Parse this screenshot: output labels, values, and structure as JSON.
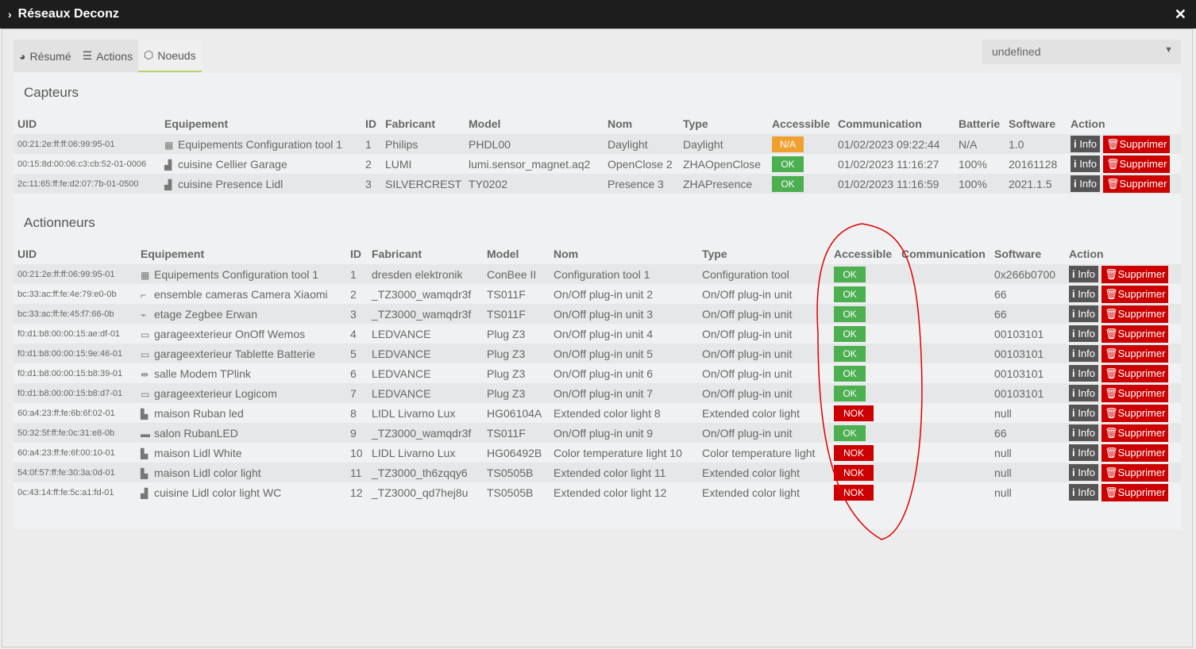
{
  "window": {
    "title": "Réseaux Deconz",
    "close": "✕"
  },
  "tabs": [
    {
      "label": "Résumé",
      "icon": "dashboard-icon"
    },
    {
      "label": "Actions",
      "icon": "sliders-icon"
    },
    {
      "label": "Noeuds",
      "icon": "cube-icon"
    }
  ],
  "select": {
    "value": "undefined"
  },
  "capteurs": {
    "title": "Capteurs",
    "headers": [
      "UID",
      "Equipement",
      "ID",
      "Fabricant",
      "Model",
      "Nom",
      "Type",
      "Accessible",
      "Communication",
      "Batterie",
      "Software",
      "Action"
    ],
    "rows": [
      [
        "00:21:2e:ff:ff:06:99:95-01",
        "Equipements Configuration tool 1",
        "1",
        "Philips",
        "PHDL00",
        "Daylight",
        "Daylight",
        "N/A",
        "01/02/2023 09:22:44",
        "N/A",
        "1.0"
      ],
      [
        "00:15:8d:00:06:c3:cb:52-01-0006",
        "cuisine Cellier Garage",
        "2",
        "LUMI",
        "lumi.sensor_magnet.aq2",
        "OpenClose 2",
        "ZHAOpenClose",
        "OK",
        "01/02/2023 11:16:27",
        "100%",
        "20161128"
      ],
      [
        "2c:11:65:ff:fe:d2:07:7b-01-0500",
        "cuisine Presence Lidl",
        "3",
        "SILVERCREST",
        "TY0202",
        "Presence 3",
        "ZHAPresence",
        "OK",
        "01/02/2023 11:16:59",
        "100%",
        "2021.1.5"
      ]
    ]
  },
  "actionneurs": {
    "title": "Actionneurs",
    "headers": [
      "UID",
      "Equipement",
      "ID",
      "Fabricant",
      "Model",
      "Nom",
      "Type",
      "Accessible",
      "Communication",
      "Software",
      "Action"
    ],
    "rows": [
      [
        "00:21:2e:ff:ff:06:99:95-01",
        "Equipements Configuration tool 1",
        "1",
        "dresden elektronik",
        "ConBee II",
        "Configuration tool 1",
        "Configuration tool",
        "OK",
        "",
        "0x266b0700"
      ],
      [
        "bc:33:ac:ff:fe:4e:79:e0-0b",
        "ensemble cameras Camera Xiaomi",
        "2",
        "_TZ3000_wamqdr3f",
        "TS011F",
        "On/Off plug-in unit 2",
        "On/Off plug-in unit",
        "OK",
        "",
        "66"
      ],
      [
        "bc:33:ac:ff:fe:45:f7:66-0b",
        "etage Zegbee Erwan",
        "3",
        "_TZ3000_wamqdr3f",
        "TS011F",
        "On/Off plug-in unit 3",
        "On/Off plug-in unit",
        "OK",
        "",
        "66"
      ],
      [
        "f0:d1:b8:00:00:15:ae:df-01",
        "garageexterieur OnOff Wemos",
        "4",
        "LEDVANCE",
        "Plug Z3",
        "On/Off plug-in unit 4",
        "On/Off plug-in unit",
        "OK",
        "",
        "00103101"
      ],
      [
        "f0:d1:b8:00:00:15:9e:46-01",
        "garageexterieur Tablette Batterie",
        "5",
        "LEDVANCE",
        "Plug Z3",
        "On/Off plug-in unit 5",
        "On/Off plug-in unit",
        "OK",
        "",
        "00103101"
      ],
      [
        "f0:d1:b8:00:00:15:b8:39-01",
        "salle Modem TPlink",
        "6",
        "LEDVANCE",
        "Plug Z3",
        "On/Off plug-in unit 6",
        "On/Off plug-in unit",
        "OK",
        "",
        "00103101"
      ],
      [
        "f0:d1:b8:00:00:15:b8:d7-01",
        "garageexterieur Logicom",
        "7",
        "LEDVANCE",
        "Plug Z3",
        "On/Off plug-in unit 7",
        "On/Off plug-in unit",
        "OK",
        "",
        "00103101"
      ],
      [
        "60:a4:23:ff:fe:6b:6f:02-01",
        "maison Ruban led",
        "8",
        "LIDL Livarno Lux",
        "HG06104A",
        "Extended color light 8",
        "Extended color light",
        "NOK",
        "",
        "null"
      ],
      [
        "50:32:5f:ff:fe:0c:31:e8-0b",
        "salon RubanLED",
        "9",
        "_TZ3000_wamqdr3f",
        "TS011F",
        "On/Off plug-in unit 9",
        "On/Off plug-in unit",
        "OK",
        "",
        "66"
      ],
      [
        "60:a4:23:ff:fe:6f:00:10-01",
        "maison Lidl White",
        "10",
        "LIDL Livarno Lux",
        "HG06492B",
        "Color temperature light 10",
        "Color temperature light",
        "NOK",
        "",
        "null"
      ],
      [
        "54:0f:57:ff:fe:30:3a:0d-01",
        "maison Lidl color light",
        "11",
        "_TZ3000_th6zqqy6",
        "TS0505B",
        "Extended color light 11",
        "Extended color light",
        "NOK",
        "",
        "null"
      ],
      [
        "0c:43:14:ff:fe:5c:a1:fd-01",
        "cuisine Lidl color light WC",
        "12",
        "_TZ3000_qd7hej8u",
        "TS0505B",
        "Extended color light 12",
        "Extended color light",
        "NOK",
        "",
        "null"
      ]
    ]
  },
  "actions": {
    "info": "Info",
    "delete": "Supprimer"
  },
  "colors": {
    "ok": "#4caf50",
    "na": "#f0a030",
    "nok": "#cc0000",
    "annotation": "#e00000"
  }
}
